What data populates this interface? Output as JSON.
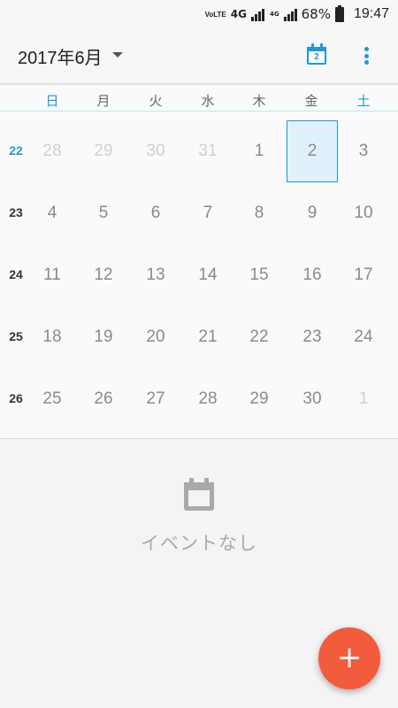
{
  "status_bar": {
    "volte": "VoLTE",
    "network_1": "4G",
    "network_2": "4G",
    "battery": "68%",
    "time": "19:47"
  },
  "toolbar": {
    "title": "2017年6月",
    "today_icon_date": "2",
    "icons": [
      "dropdown-icon",
      "calendar-today-icon",
      "overflow-menu-icon"
    ]
  },
  "calendar": {
    "weekdays": [
      "日",
      "月",
      "火",
      "水",
      "木",
      "金",
      "土"
    ],
    "weeks": [
      {
        "number": "22",
        "current": true,
        "days": [
          "28",
          "29",
          "30",
          "31",
          "1",
          "2",
          "3"
        ]
      },
      {
        "number": "23",
        "current": false,
        "days": [
          "4",
          "5",
          "6",
          "7",
          "8",
          "9",
          "10"
        ]
      },
      {
        "number": "24",
        "current": false,
        "days": [
          "11",
          "12",
          "13",
          "14",
          "15",
          "16",
          "17"
        ]
      },
      {
        "number": "25",
        "current": false,
        "days": [
          "18",
          "19",
          "20",
          "21",
          "22",
          "23",
          "24"
        ]
      },
      {
        "number": "26",
        "current": false,
        "days": [
          "25",
          "26",
          "27",
          "28",
          "29",
          "30",
          "1"
        ]
      }
    ],
    "selected_date": "2",
    "colors": {
      "accent": "#1a9ad6",
      "selected_bg": "#e1f0fa",
      "fab": "#f35b3d"
    }
  },
  "events": {
    "empty_message": "イベントなし",
    "empty_icon": "calendar-icon"
  },
  "fab": {
    "label": "+",
    "icon": "add-icon"
  }
}
